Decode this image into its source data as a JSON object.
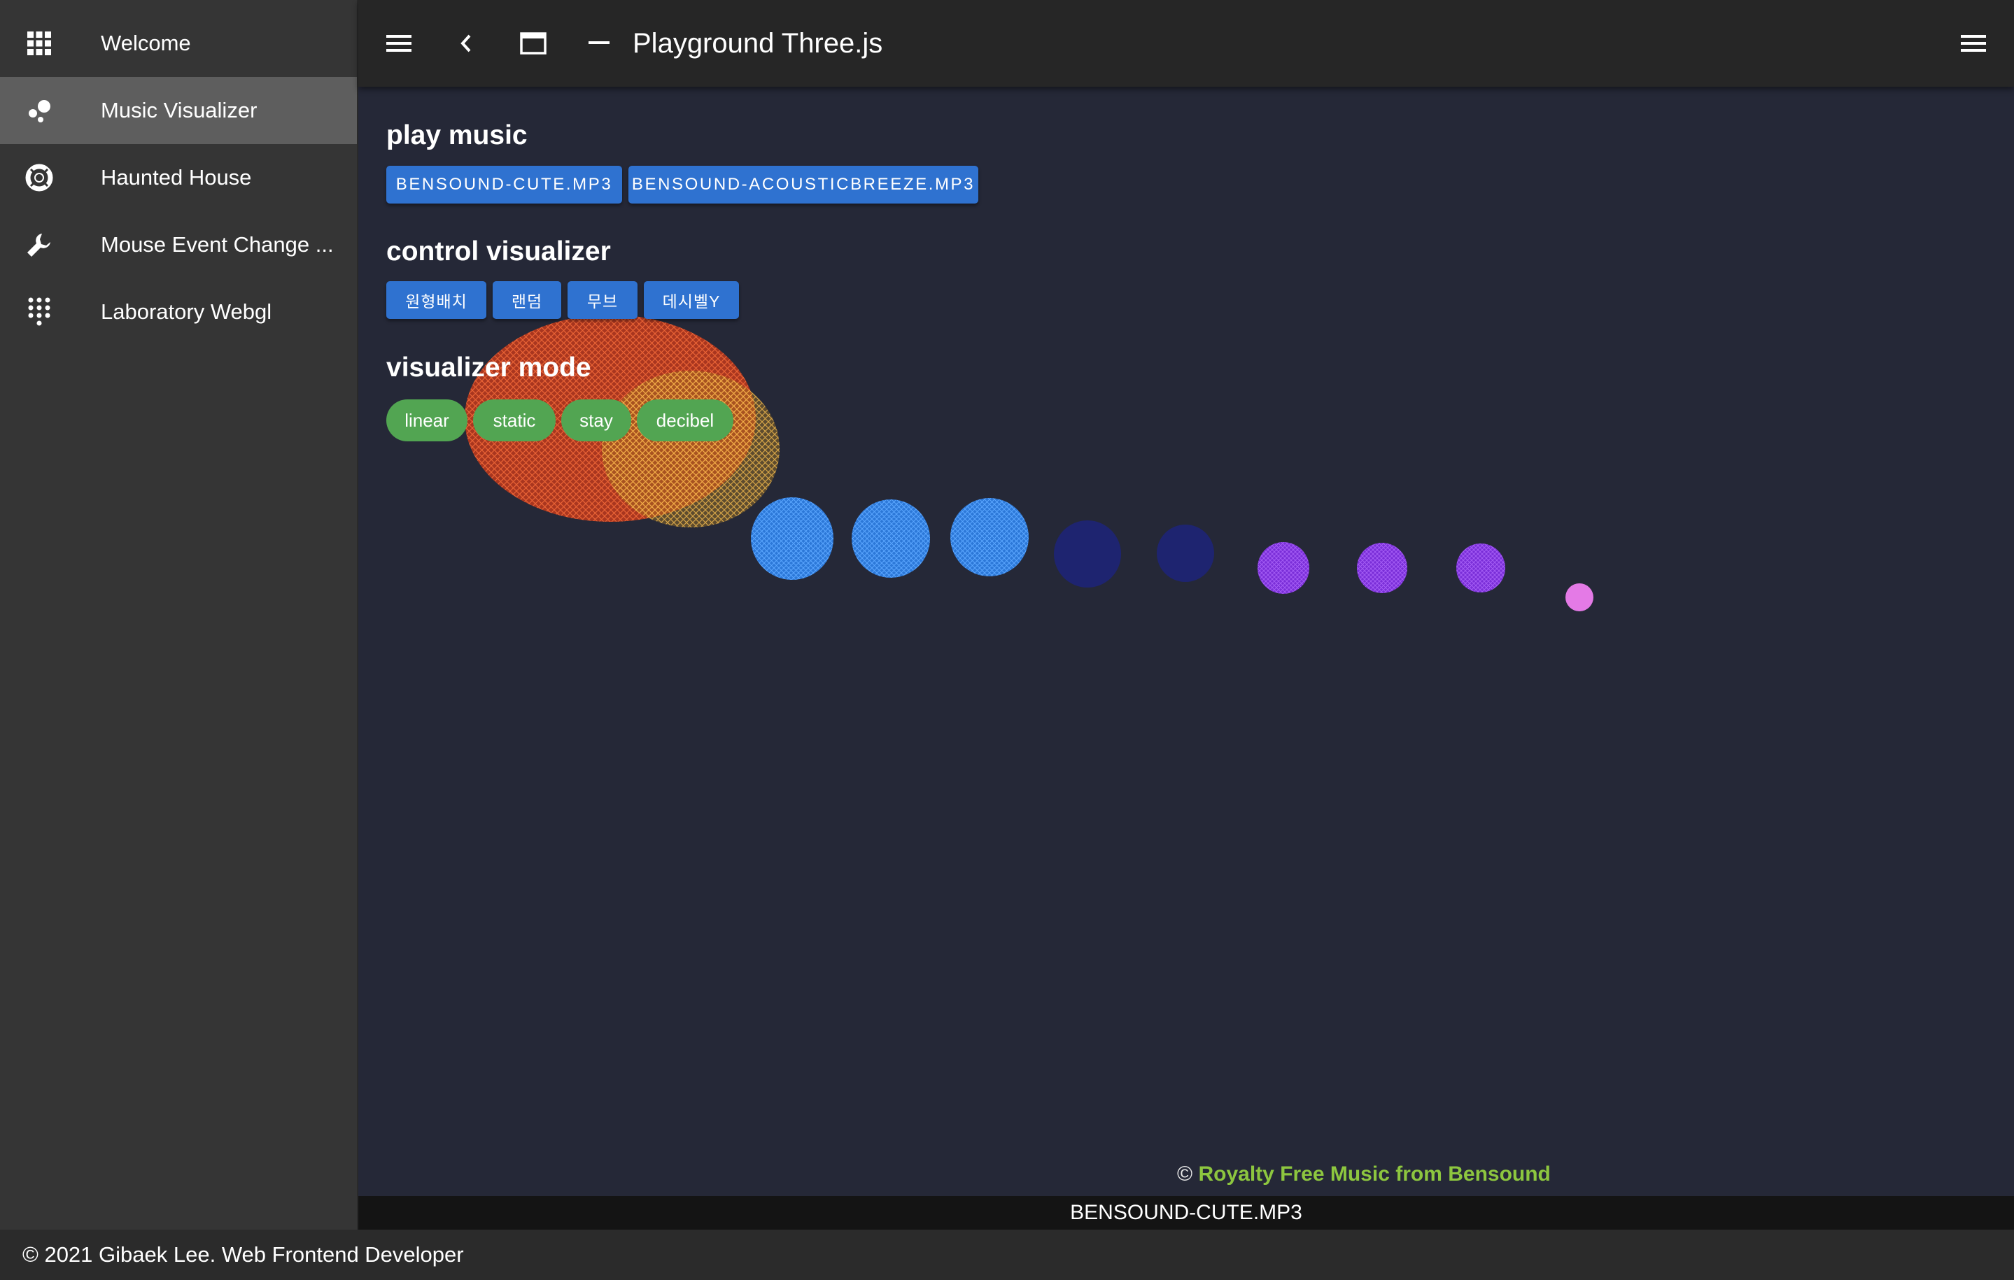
{
  "sidebar": {
    "items": [
      {
        "label": "Welcome",
        "icon": "apps-grid-icon",
        "active": false
      },
      {
        "label": "Music Visualizer",
        "icon": "bubbles-icon",
        "active": true
      },
      {
        "label": "Haunted House",
        "icon": "lifebuoy-icon",
        "active": false
      },
      {
        "label": "Mouse Event Change ...",
        "icon": "wrench-icon",
        "active": false
      },
      {
        "label": "Laboratory Webgl",
        "icon": "dialpad-icon",
        "active": false
      }
    ]
  },
  "topbar": {
    "title": "Playground Three.js",
    "icons": [
      "menu-icon",
      "back-chevron-icon",
      "window-icon",
      "minimize-icon",
      "menu-icon"
    ]
  },
  "sections": {
    "play_music": {
      "title": "play music",
      "buttons": [
        "BENSOUND-CUTE.MP3",
        "BENSOUND-ACOUSTICBREEZE.MP3"
      ]
    },
    "control_visualizer": {
      "title": "control visualizer",
      "buttons": [
        "원형배치",
        "랜덤",
        "무브",
        "데시벨Y"
      ]
    },
    "visualizer_mode": {
      "title": "visualizer mode",
      "chips": [
        "linear",
        "static",
        "stay",
        "decibel"
      ]
    }
  },
  "credit": {
    "symbol": "©",
    "link": "Royalty Free Music from Bensound"
  },
  "now_playing": "BENSOUND-CUTE.MP3",
  "footer": "© 2021 Gibaek Lee. Web Frontend Developer",
  "colors": {
    "sidebar_bg": "#353535",
    "sidebar_active": "#5e5e5e",
    "topbar_bg": "#262626",
    "main_bg": "#252837",
    "button_blue": "#2f72d0",
    "chip_green": "#52a552",
    "credit_link": "#8dc63f",
    "sphere_red": "#f0522a",
    "sphere_yellow": "#e0a83a",
    "sphere_blue": "#3d8ef0",
    "sphere_navy": "#1e2470",
    "sphere_purple": "#8a3ae0",
    "sphere_pink": "#e47ae6"
  }
}
